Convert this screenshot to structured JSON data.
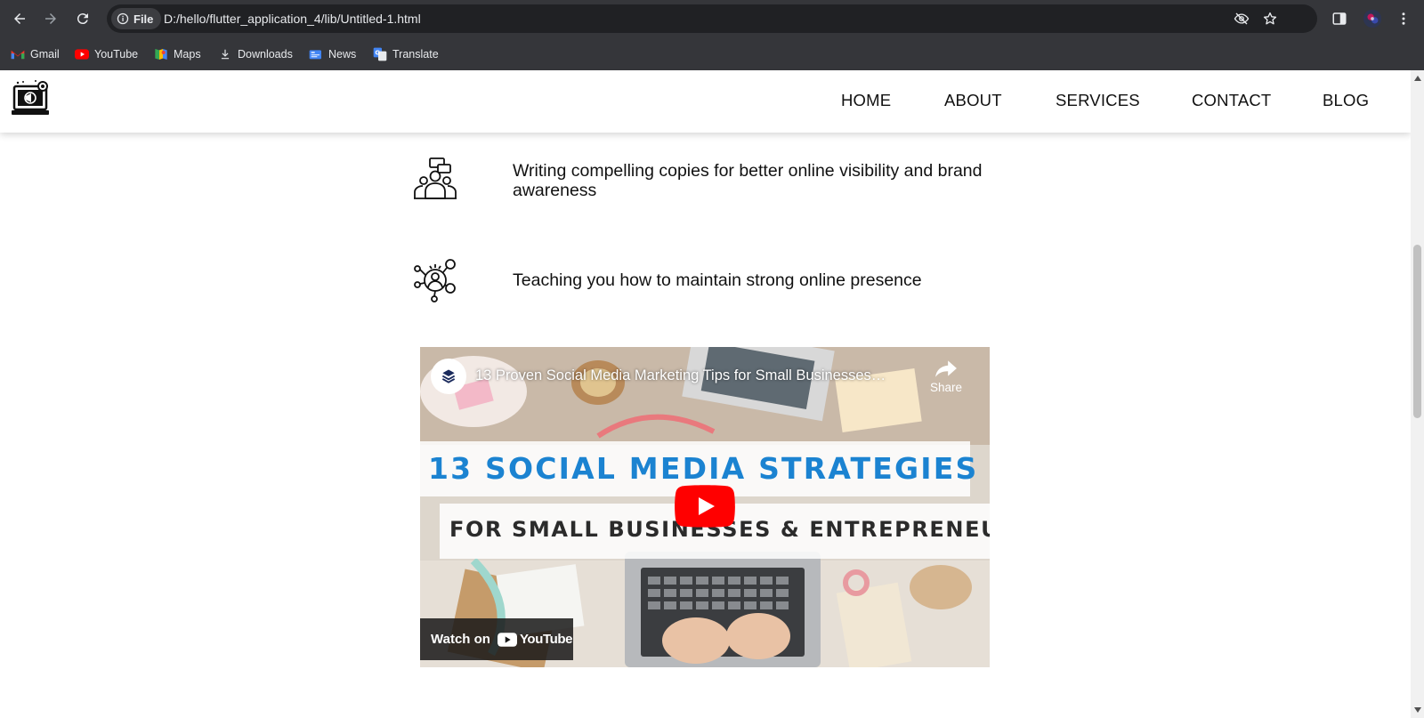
{
  "browser": {
    "site_chip_label": "File",
    "url": "D:/hello/flutter_application_4/lib/Untitled-1.html",
    "bookmarks": [
      {
        "label": "Gmail",
        "icon": "gmail-icon"
      },
      {
        "label": "YouTube",
        "icon": "youtube-icon"
      },
      {
        "label": "Maps",
        "icon": "maps-icon"
      },
      {
        "label": "Downloads",
        "icon": "download-icon"
      },
      {
        "label": "News",
        "icon": "news-icon"
      },
      {
        "label": "Translate",
        "icon": "translate-icon"
      }
    ]
  },
  "header": {
    "menu": [
      "HOME",
      "ABOUT",
      "SERVICES",
      "CONTACT",
      "BLOG"
    ]
  },
  "features": [
    {
      "text": "Writing compelling copies for better online visibility and brand awareness",
      "icon": "copywriting-team-icon"
    },
    {
      "text": "Teaching you how to maintain strong online presence",
      "icon": "network-person-icon"
    }
  ],
  "video": {
    "title": "13 Proven Social Media Marketing Tips for Small Businesses…",
    "share_label": "Share",
    "banner_line1": "13 SOCIAL MEDIA STRATEGIES",
    "banner_line2": "FOR SMALL BUSINESSES & ENTREPRENEURS",
    "watch_on_label": "Watch on",
    "youtube_wordmark": "YouTube"
  },
  "colors": {
    "chrome_bg": "#35363a",
    "page_bg": "#ffffff",
    "banner_blue": "#1b83d1",
    "youtube_red": "#ff0000"
  }
}
